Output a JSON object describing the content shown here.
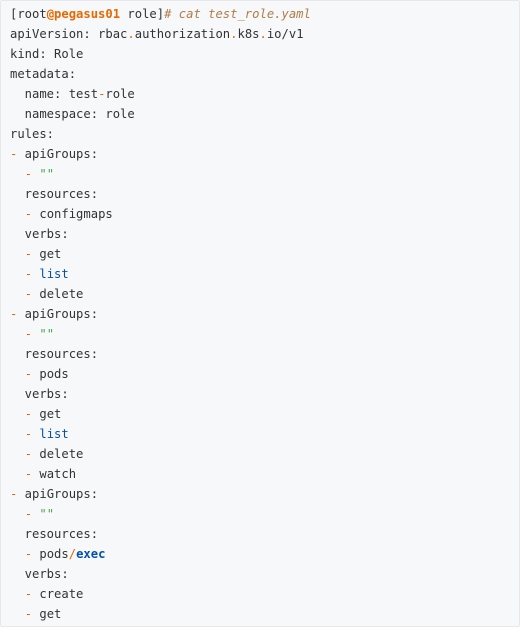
{
  "terminal": {
    "prompt": {
      "open": "[root",
      "host": "@pegasus01",
      "dir": " role]",
      "command": "# cat test_role.yaml"
    },
    "lines": {
      "api_version_a": "apiVersion: rbac",
      "api_version_dot1": ".",
      "api_version_b": "authorization",
      "api_version_dot2": ".",
      "api_version_c": "k8s",
      "api_version_dot3": ".",
      "api_version_d": "io/v1",
      "kind": "kind: Role",
      "metadata": "metadata:",
      "name_a": "  name: test",
      "name_dash": "-",
      "name_b": "role",
      "namespace": "  namespace: role",
      "rules": "rules:",
      "item_dash": "-",
      "api_groups": " apiGroups:",
      "indent": "  ",
      "empty_string": " \"\"",
      "resources": "  resources:",
      "verbs": "  verbs:",
      "configmaps": " configmaps",
      "pods": " pods",
      "pods_exec_a": " pods",
      "pods_exec_slash": "/",
      "pods_exec_b": "exec",
      "get": " get",
      "list": " list",
      "delete": " delete",
      "watch": " watch",
      "create": " create"
    }
  },
  "colors": {
    "background": "#f6f8fa",
    "text": "#333333",
    "accent_orange": "#e96900",
    "comment_brown": "#b07d48",
    "string_green": "#50a14f",
    "keyword_blue": "#0550ae"
  }
}
